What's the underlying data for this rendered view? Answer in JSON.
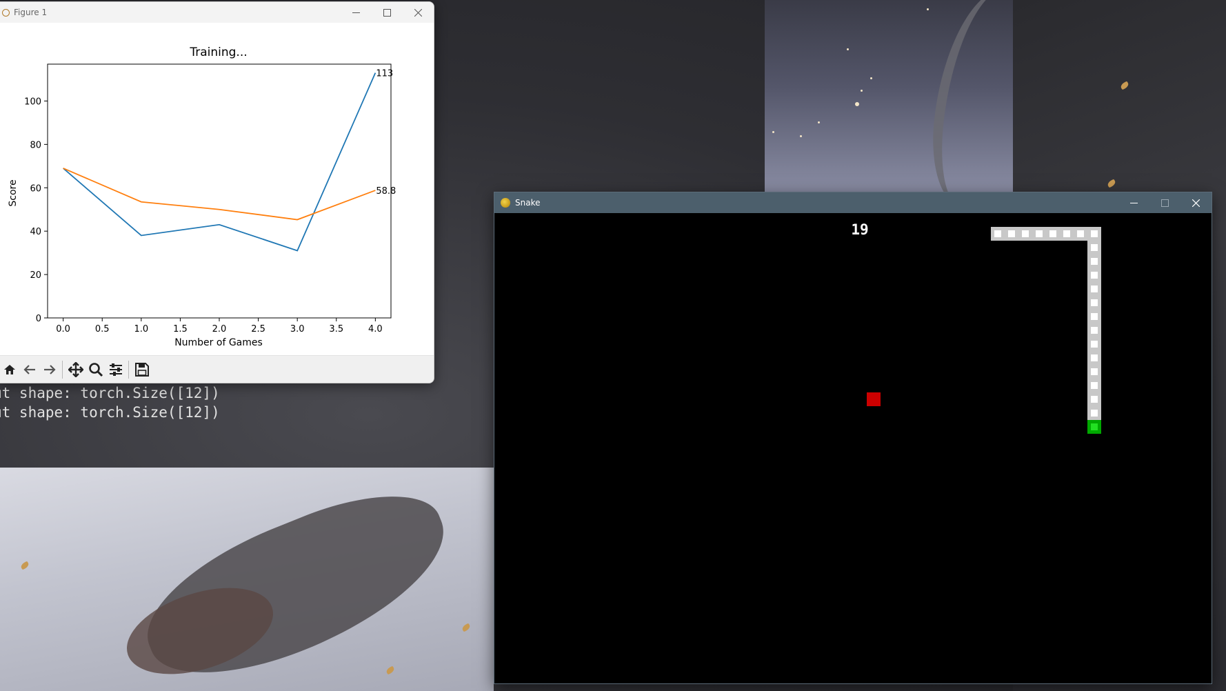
{
  "desktop": {
    "terminal_lines": [
      "ut shape: torch.Size([12])",
      "ut shape: torch.Size([12])"
    ]
  },
  "figure_window": {
    "title": "Figure 1",
    "toolbar_icons": [
      "home-icon",
      "back-icon",
      "forward-icon",
      "pan-icon",
      "zoom-icon",
      "configure-subplots-icon",
      "save-icon"
    ]
  },
  "chart_data": {
    "type": "line",
    "title": "Training...",
    "xlabel": "Number of Games",
    "ylabel": "Score",
    "xlim": [
      -0.2,
      4.2
    ],
    "ylim": [
      0,
      117
    ],
    "xticks": [
      "0.0",
      "0.5",
      "1.0",
      "1.5",
      "2.0",
      "2.5",
      "3.0",
      "3.5",
      "4.0"
    ],
    "yticks": [
      "0",
      "20",
      "40",
      "60",
      "80",
      "100"
    ],
    "series": [
      {
        "color": "#1f77b4",
        "x": [
          0,
          1,
          2,
          3,
          4
        ],
        "y": [
          69,
          38,
          43,
          31,
          113
        ]
      },
      {
        "color": "#ff7f0e",
        "x": [
          0,
          1,
          2,
          3,
          4
        ],
        "y": [
          69,
          53.5,
          50,
          45.3,
          58.8
        ]
      }
    ],
    "annotations": [
      {
        "x": 4,
        "y": 113,
        "text": "113"
      },
      {
        "x": 4,
        "y": 58.8,
        "text": "58.8"
      }
    ],
    "grid": false
  },
  "snake_window": {
    "title": "Snake",
    "score": "19",
    "colors": {
      "background": "#000000",
      "food": "#cc0000",
      "body": "#c8c8c8",
      "head": "#00a800"
    }
  }
}
